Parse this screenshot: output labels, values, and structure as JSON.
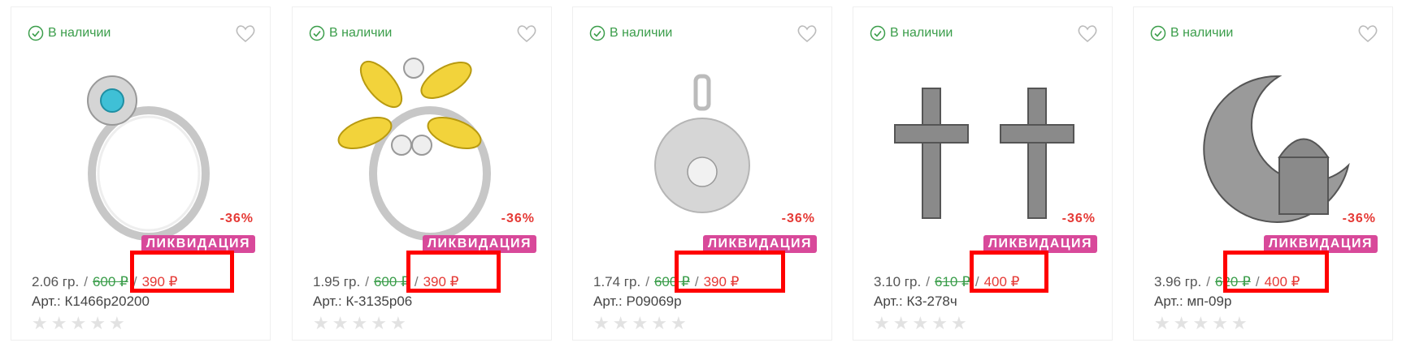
{
  "products": [
    {
      "stock": "В наличии",
      "icon": "ring-blue-stone",
      "discount": "-36%",
      "badge": "ЛИКВИДАЦИЯ",
      "weight": "2.06 гр.",
      "old_price": "600 ₽",
      "new_price": "390 ₽",
      "article": "Арт.: К1466р20200",
      "rating": 0
    },
    {
      "stock": "В наличии",
      "icon": "ring-yellow-flower",
      "discount": "-36%",
      "badge": "ЛИКВИДАЦИЯ",
      "weight": "1.95 гр.",
      "old_price": "600 ₽",
      "new_price": "390 ₽",
      "article": "Арт.: К-3135р06",
      "rating": 0
    },
    {
      "stock": "В наличии",
      "icon": "pendant-ball",
      "discount": "-36%",
      "badge": "ЛИКВИДАЦИЯ",
      "weight": "1.74 гр.",
      "old_price": "600 ₽",
      "new_price": "390 ₽",
      "article": "Арт.: Р09069р",
      "rating": 0
    },
    {
      "stock": "В наличии",
      "icon": "cross-pendant",
      "discount": "-36%",
      "badge": "ЛИКВИДАЦИЯ",
      "weight": "3.10 гр.",
      "old_price": "610 ₽",
      "new_price": "400 ₽",
      "article": "Арт.: К3-278ч",
      "rating": 0
    },
    {
      "stock": "В наличии",
      "icon": "crescent-mosque-pendant",
      "discount": "-36%",
      "badge": "ЛИКВИДАЦИЯ",
      "weight": "3.96 гр.",
      "old_price": "620 ₽",
      "new_price": "400 ₽",
      "article": "Арт.: мп-09р",
      "rating": 0
    }
  ],
  "colors": {
    "stock_green": "#3a9d4a",
    "discount_red": "#e53935",
    "badge_pink": "#d8499a",
    "highlight_red": "#ff0000"
  }
}
